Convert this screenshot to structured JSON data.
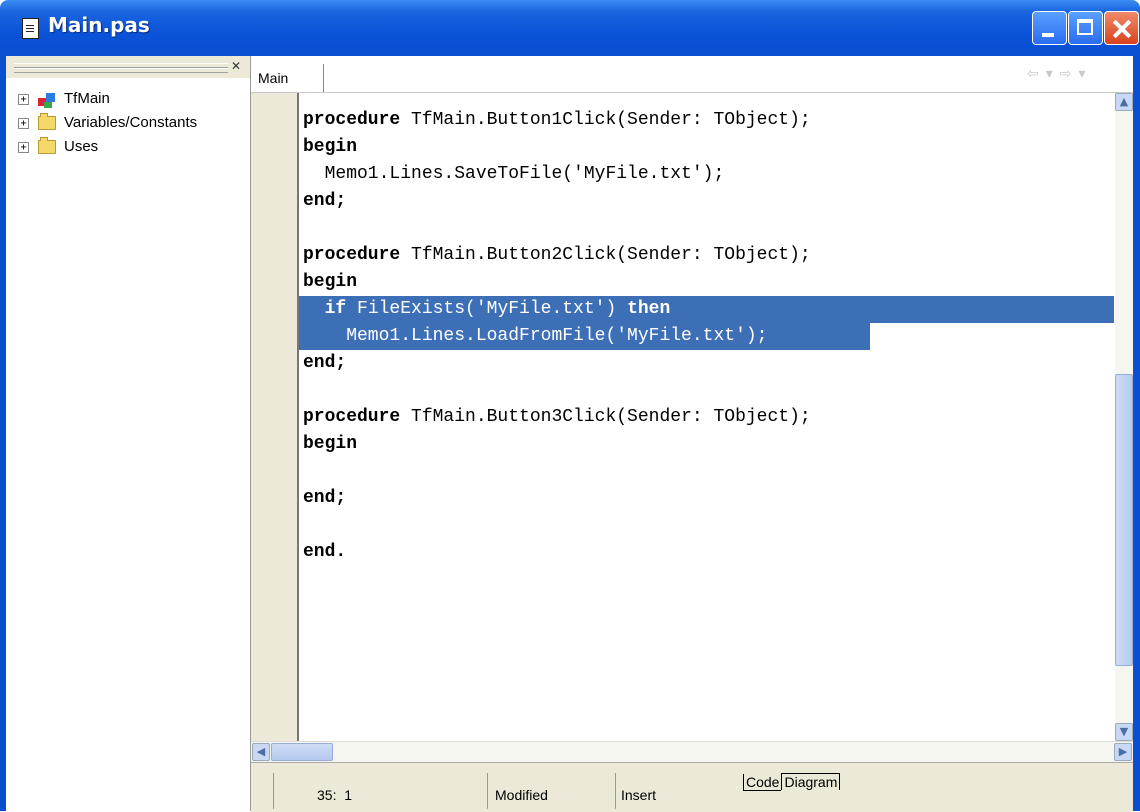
{
  "window": {
    "title": "Main.pas",
    "title_icon": "document-icon",
    "controls": [
      "minimize",
      "maximize",
      "close"
    ],
    "colors": {
      "title_bar": "#0b4fd1",
      "selection": "#3d6fb7",
      "close_button": "#d9421c"
    }
  },
  "explorer": {
    "close_glyph": "✕",
    "items": [
      {
        "expander": "+",
        "icon": "class-icon",
        "label": "TfMain"
      },
      {
        "expander": "+",
        "icon": "folder-icon",
        "label": "Variables/Constants"
      },
      {
        "expander": "+",
        "icon": "folder-icon",
        "label": "Uses"
      }
    ]
  },
  "tabs": {
    "active_label": "Main"
  },
  "nav": {
    "back": "⇦",
    "back_drop": "▾",
    "forward": "⇨",
    "forward_drop": "▾"
  },
  "code": {
    "lines": [
      {
        "kw": "procedure",
        "text": " TfMain.Button1Click(Sender: TObject);",
        "selected": false
      },
      {
        "kw": "begin",
        "text": "",
        "selected": false
      },
      {
        "kw": "",
        "text": "  Memo1.Lines.SaveToFile('MyFile.txt');",
        "selected": false
      },
      {
        "kw": "end;",
        "text": "",
        "selected": false
      },
      {
        "kw": "",
        "text": "",
        "selected": false
      },
      {
        "kw": "procedure",
        "text": " TfMain.Button2Click(Sender: TObject);",
        "selected": false
      },
      {
        "kw": "begin",
        "text": "",
        "selected": false
      },
      {
        "kw": "",
        "text": "  if FileExists('MyFile.txt') then",
        "selected": true
      },
      {
        "kw": "",
        "text": "    Memo1.Lines.LoadFromFile('MyFile.txt');",
        "selected": true
      },
      {
        "kw": "end;",
        "text": "",
        "selected": false
      },
      {
        "kw": "",
        "text": "",
        "selected": false
      },
      {
        "kw": "procedure",
        "text": " TfMain.Button3Click(Sender: TObject);",
        "selected": false
      },
      {
        "kw": "begin",
        "text": "",
        "selected": false
      },
      {
        "kw": "",
        "text": "",
        "selected": false
      },
      {
        "kw": "end;",
        "text": "",
        "selected": false
      },
      {
        "kw": "",
        "text": "",
        "selected": false
      },
      {
        "kw": "end.",
        "text": "",
        "selected": false
      }
    ]
  },
  "scrollbars": {
    "up": "▲",
    "down": "▼",
    "left": "◀",
    "right": "▶"
  },
  "status": {
    "position": "35:  1",
    "modified": "Modified",
    "mode": "Insert",
    "view_tabs": [
      "Code",
      "Diagram"
    ]
  }
}
